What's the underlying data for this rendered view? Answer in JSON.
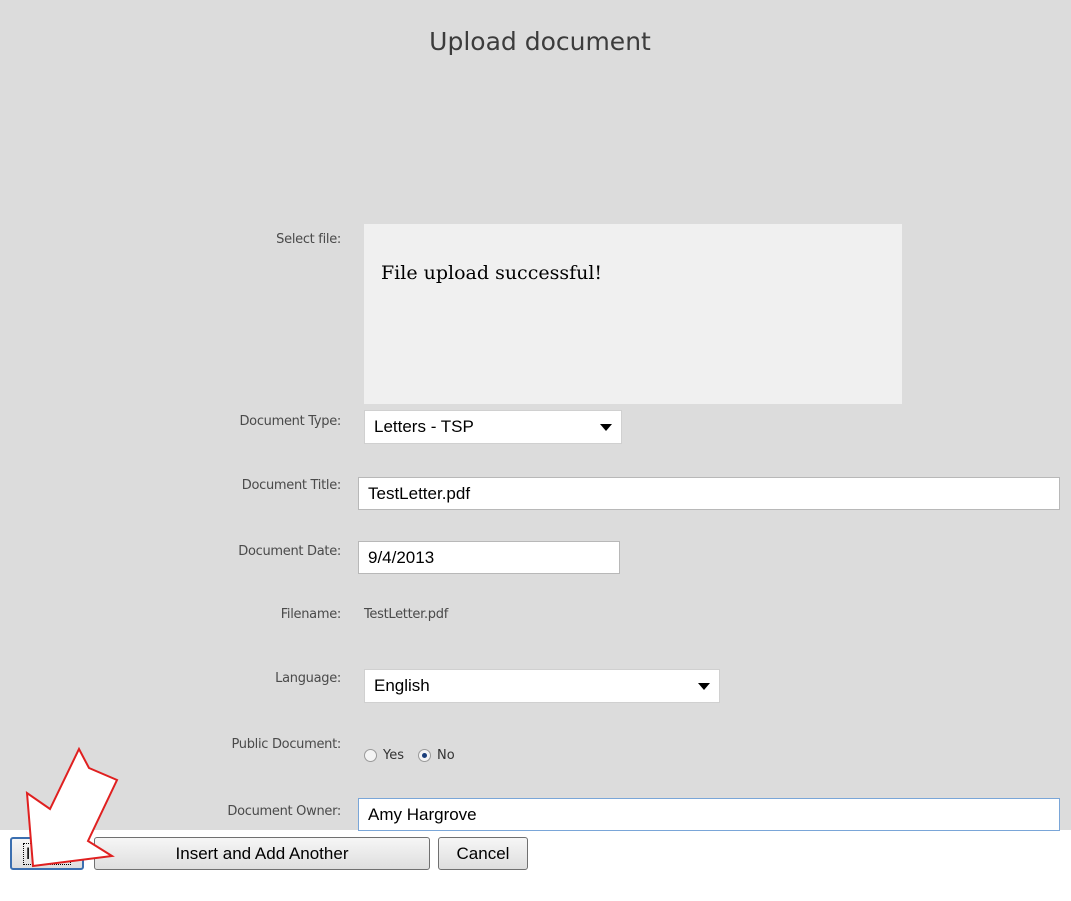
{
  "form": {
    "title": "Upload document",
    "labels": {
      "select_file": "Select file:",
      "document_type": "Document Type:",
      "document_title": "Document Title:",
      "document_date": "Document Date:",
      "filename": "Filename:",
      "language": "Language:",
      "public_document": "Public Document:",
      "document_owner": "Document Owner:"
    },
    "upload_message": "File upload successful!",
    "document_type_value": "Letters - TSP",
    "document_title_value": "TestLetter.pdf",
    "document_date_value": "9/4/2013",
    "filename_value": "TestLetter.pdf",
    "language_value": "English",
    "public_document": {
      "options": [
        "Yes",
        "No"
      ],
      "selected": "No"
    },
    "document_owner_value": "Amy Hargrove"
  },
  "buttons": {
    "insert": "Insert",
    "insert_add_another": "Insert and Add Another",
    "cancel": "Cancel"
  },
  "annotation": {
    "arrow_color": "#e02020",
    "arrow_fill": "#ffffff"
  }
}
